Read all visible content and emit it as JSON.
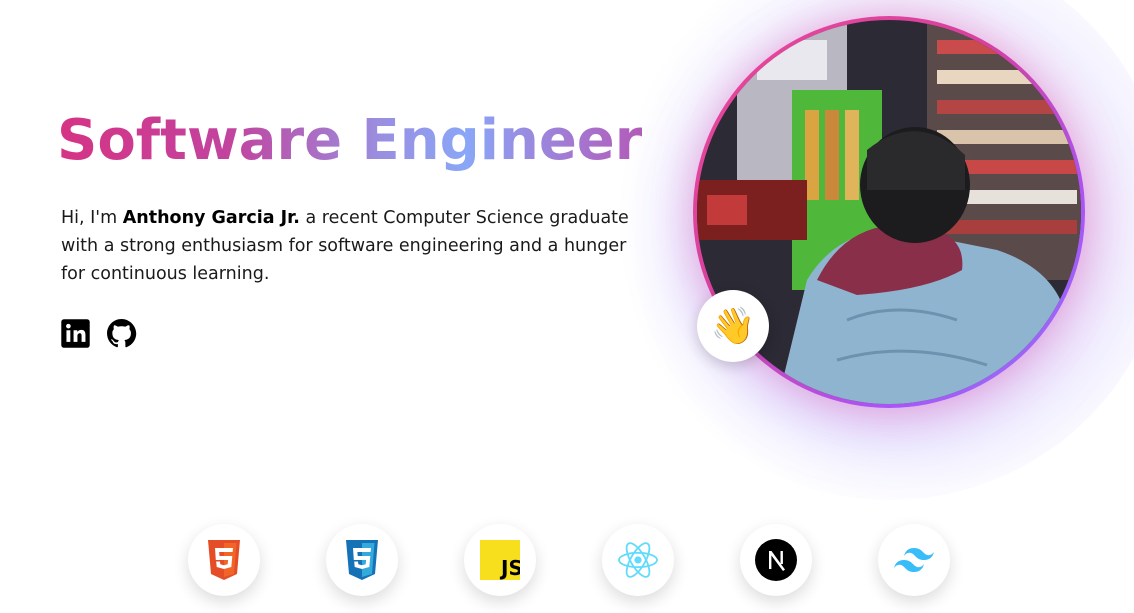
{
  "hero": {
    "title": "Software Engineer",
    "intro_prefix": "Hi, I'm ",
    "name": "Anthony Garcia Jr.",
    "intro_suffix": " a recent Computer Science graduate with a strong enthusiasm for software engineering and a hunger for continuous learning."
  },
  "socials": [
    {
      "icon": "linkedin-icon"
    },
    {
      "icon": "github-icon"
    }
  ],
  "photo": {
    "icon": "profile-photo"
  },
  "wave_badge": {
    "emoji": "👋",
    "icon": "waving-hand-icon"
  },
  "tech_stack": [
    {
      "icon": "html5-icon",
      "color": "#E44D26"
    },
    {
      "icon": "css3-icon",
      "color": "#1572B6"
    },
    {
      "icon": "javascript-icon",
      "color": "#F7DF1E"
    },
    {
      "icon": "react-icon",
      "color": "#61DAFB"
    },
    {
      "icon": "nextjs-icon",
      "color": "#000000"
    },
    {
      "icon": "tailwind-icon",
      "color": "#38BDF8"
    }
  ],
  "colors": {
    "gradient_pink": "#d63384",
    "gradient_blue": "#8aa6f7",
    "ring_pink": "#ec4899",
    "ring_purple": "#8b7cf6"
  }
}
